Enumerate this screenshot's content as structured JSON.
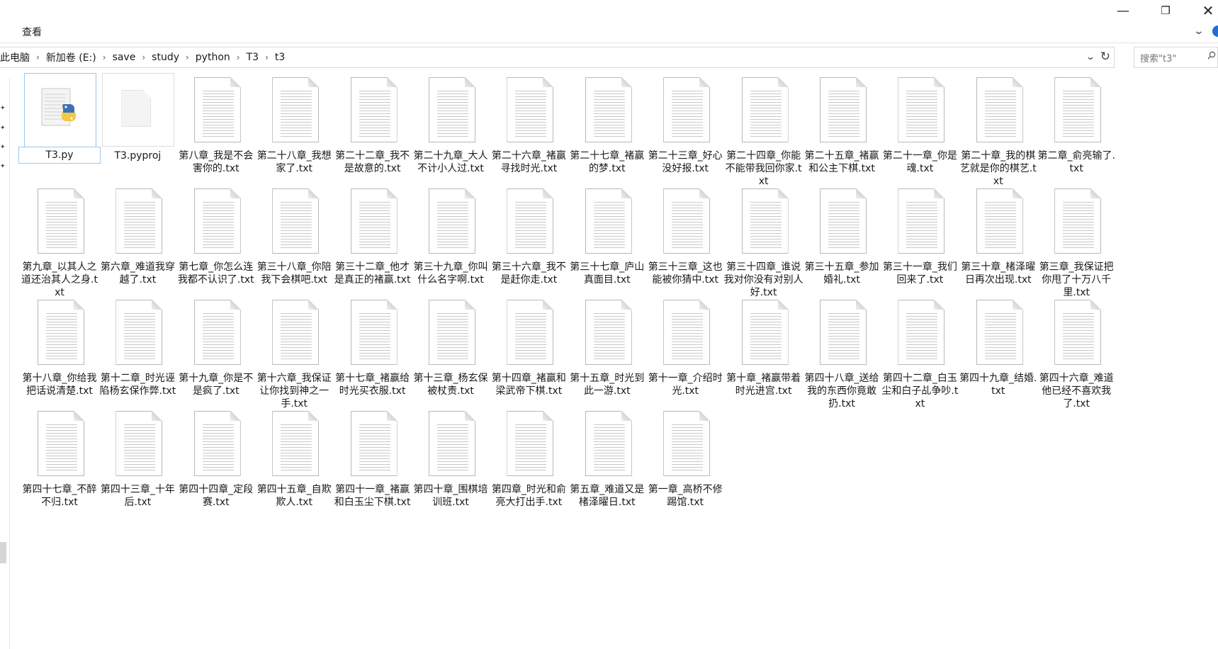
{
  "window": {
    "minimize_icon": "minimize-icon",
    "restore_icon": "restore-icon",
    "close_icon": "close-icon"
  },
  "ribbon": {
    "tab_view": "查看"
  },
  "address": {
    "crumbs": [
      "此电脑",
      "新加卷 (E:)",
      "save",
      "study",
      "python",
      "T3",
      "t3"
    ]
  },
  "search": {
    "placeholder": "搜索\"t3\""
  },
  "files": [
    {
      "name": "T3.py",
      "kind": "python"
    },
    {
      "name": "T3.pyproj",
      "kind": "blank"
    },
    {
      "name": "第八章_我是不会害你的.txt",
      "kind": "txt"
    },
    {
      "name": "第二十八章_我想家了.txt",
      "kind": "txt"
    },
    {
      "name": "第二十二章_我不是故意的.txt",
      "kind": "txt"
    },
    {
      "name": "第二十九章_大人不计小人过.txt",
      "kind": "txt"
    },
    {
      "name": "第二十六章_褚赢寻找时光.txt",
      "kind": "txt"
    },
    {
      "name": "第二十七章_褚赢的梦.txt",
      "kind": "txt"
    },
    {
      "name": "第二十三章_好心没好报.txt",
      "kind": "txt"
    },
    {
      "name": "第二十四章_你能不能带我回你家.txt",
      "kind": "txt"
    },
    {
      "name": "第二十五章_褚赢和公主下棋.txt",
      "kind": "txt"
    },
    {
      "name": "第二十一章_你是魂.txt",
      "kind": "txt"
    },
    {
      "name": "第二十章_我的棋艺就是你的棋艺.txt",
      "kind": "txt"
    },
    {
      "name": "第二章_俞亮输了.txt",
      "kind": "txt"
    },
    {
      "name": "第九章_以其人之道还治其人之身.txt",
      "kind": "txt"
    },
    {
      "name": "第六章_难道我穿越了.txt",
      "kind": "txt"
    },
    {
      "name": "第七章_你怎么连我都不认识了.txt",
      "kind": "txt"
    },
    {
      "name": "第三十八章_你陪我下会棋吧.txt",
      "kind": "txt"
    },
    {
      "name": "第三十二章_他才是真正的褚赢.txt",
      "kind": "txt"
    },
    {
      "name": "第三十九章_你叫什么名字啊.txt",
      "kind": "txt"
    },
    {
      "name": "第三十六章_我不是赶你走.txt",
      "kind": "txt"
    },
    {
      "name": "第三十七章_庐山真面目.txt",
      "kind": "txt"
    },
    {
      "name": "第三十三章_这也能被你猜中.txt",
      "kind": "txt"
    },
    {
      "name": "第三十四章_谁说我对你没有对别人好.txt",
      "kind": "txt"
    },
    {
      "name": "第三十五章_参加婚礼.txt",
      "kind": "txt"
    },
    {
      "name": "第三十一章_我们回来了.txt",
      "kind": "txt"
    },
    {
      "name": "第三十章_楮泽曜日再次出现.txt",
      "kind": "txt"
    },
    {
      "name": "第三章_我保证把你甩了十万八千里.txt",
      "kind": "txt"
    },
    {
      "name": "第十八章_你给我把话说清楚.txt",
      "kind": "txt"
    },
    {
      "name": "第十二章_时光诬陷杨玄保作弊.txt",
      "kind": "txt"
    },
    {
      "name": "第十九章_你是不是疯了.txt",
      "kind": "txt"
    },
    {
      "name": "第十六章_我保证让你找到神之一手.txt",
      "kind": "txt"
    },
    {
      "name": "第十七章_褚赢给时光买衣服.txt",
      "kind": "txt"
    },
    {
      "name": "第十三章_杨玄保被杖责.txt",
      "kind": "txt"
    },
    {
      "name": "第十四章_褚赢和梁武帝下棋.txt",
      "kind": "txt"
    },
    {
      "name": "第十五章_时光到此一游.txt",
      "kind": "txt"
    },
    {
      "name": "第十一章_介绍时光.txt",
      "kind": "txt"
    },
    {
      "name": "第十章_褚赢带着时光进宫.txt",
      "kind": "txt"
    },
    {
      "name": "第四十八章_送给我的东西你竟敢扔.txt",
      "kind": "txt"
    },
    {
      "name": "第四十二章_白玉尘和白子乩争吵.txt",
      "kind": "txt"
    },
    {
      "name": "第四十九章_结婚.txt",
      "kind": "txt"
    },
    {
      "name": "第四十六章_难道他已经不喜欢我了.txt",
      "kind": "txt"
    },
    {
      "name": "第四十七章_不醉不归.txt",
      "kind": "txt"
    },
    {
      "name": "第四十三章_十年后.txt",
      "kind": "txt"
    },
    {
      "name": "第四十四章_定段赛.txt",
      "kind": "txt"
    },
    {
      "name": "第四十五章_自欺欺人.txt",
      "kind": "txt"
    },
    {
      "name": "第四十一章_褚赢和白玉尘下棋.txt",
      "kind": "txt"
    },
    {
      "name": "第四十章_围棋培训班.txt",
      "kind": "txt"
    },
    {
      "name": "第四章_时光和俞亮大打出手.txt",
      "kind": "txt"
    },
    {
      "name": "第五章_难道又是楮泽曜日.txt",
      "kind": "txt"
    },
    {
      "name": "第一章_高桥不修踢馆.txt",
      "kind": "txt"
    }
  ]
}
